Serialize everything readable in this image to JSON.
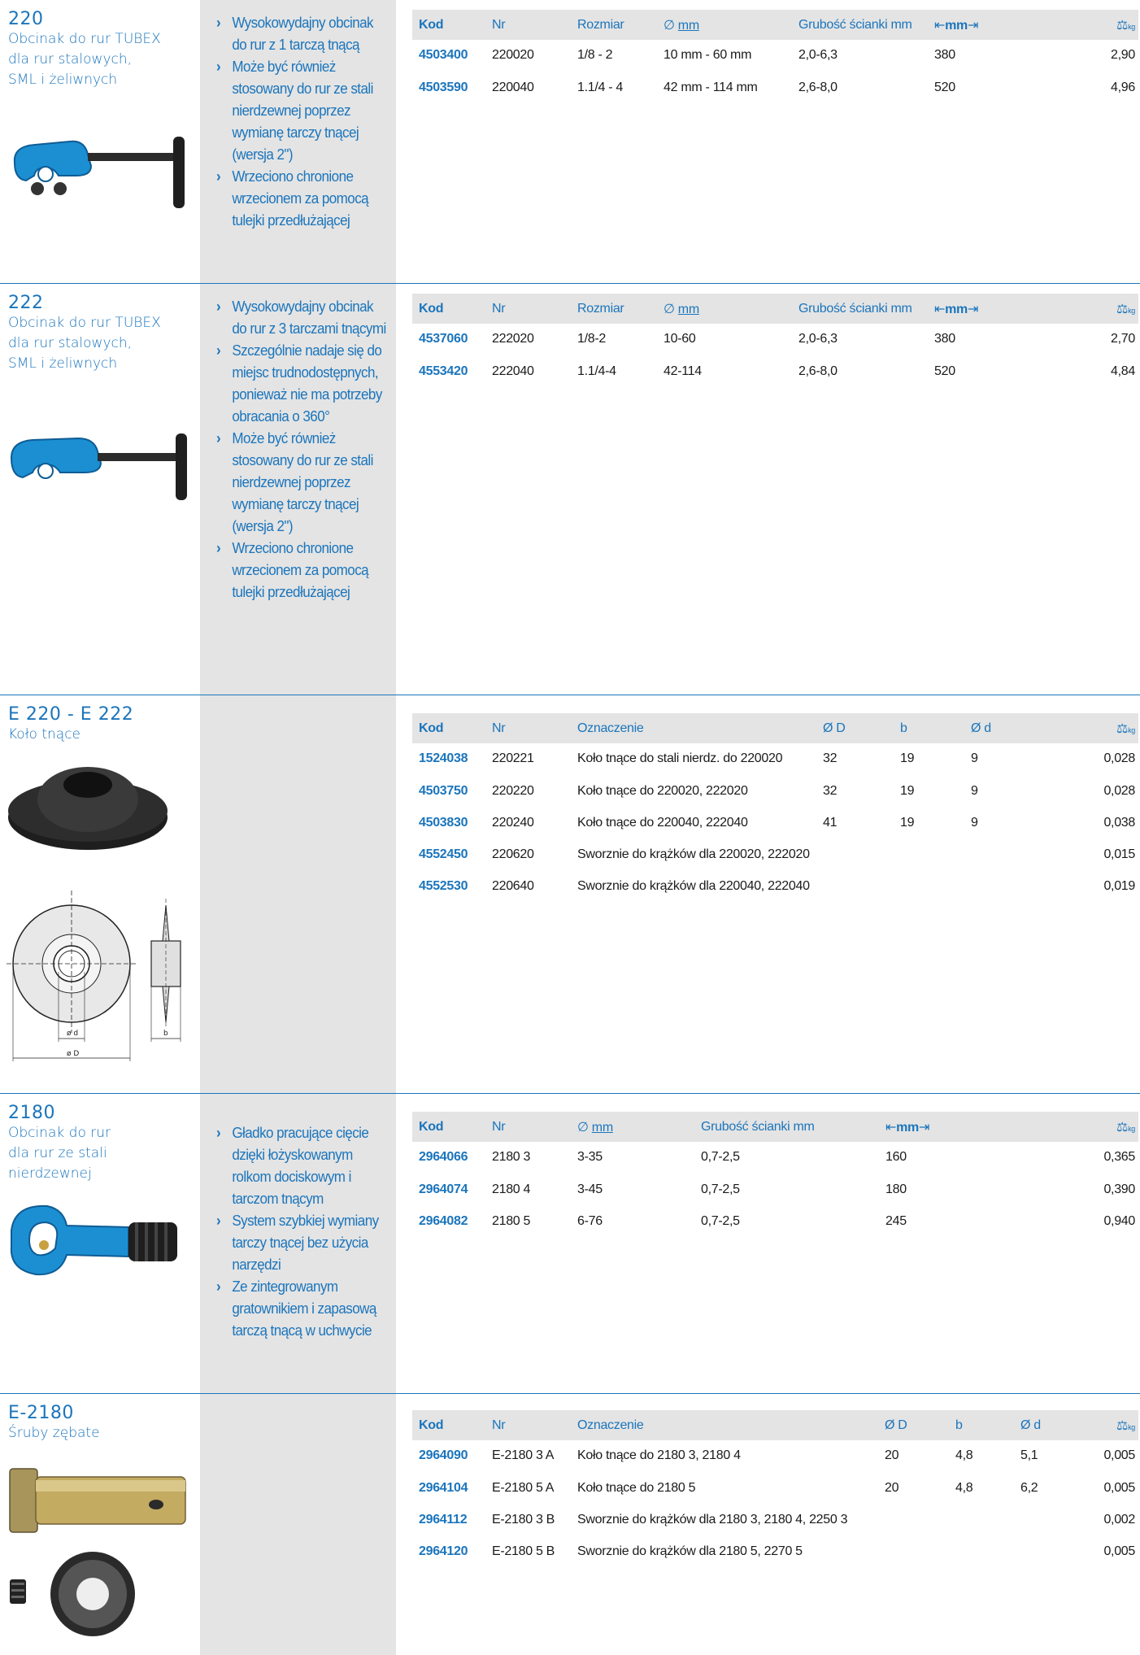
{
  "colors": {
    "accent": "#1b75bc",
    "panel": "#e4e4e4"
  },
  "sections": [
    {
      "number": "220",
      "title_lines": [
        "Obcinak do rur TUBEX",
        "dla rur stalowych,",
        "SML i żeliwnych"
      ],
      "features": [
        "Wysokowydajny obcinak do rur z 1 tarczą tnącą",
        "Może być również stosowany do rur ze stali nierdzewnej poprzez wymianę tarczy tnącej (wersja 2\")",
        "Wrzeciono chronione wrzecionem za pomocą tulejki przedłużającej"
      ],
      "headers": [
        "Kod",
        "Nr",
        "Rozmiar",
        "mm",
        "Grubość ścianki mm",
        "mm",
        "kg"
      ],
      "rows": [
        [
          "4503400",
          "220020",
          "1/8 - 2",
          "10 mm - 60 mm",
          "2,0-6,3",
          "380",
          "2,90"
        ],
        [
          "4503590",
          "220040",
          "1.1/4 - 4",
          "42 mm - 114 mm",
          "2,6-8,0",
          "520",
          "4,96"
        ]
      ]
    },
    {
      "number": "222",
      "title_lines": [
        "Obcinak do rur TUBEX",
        "dla rur stalowych,",
        "SML i żeliwnych"
      ],
      "features": [
        "Wysokowydajny obcinak do rur z 3 tarczami tnącymi",
        "Szczególnie nadaje się do miejsc trudnodostępnych, ponieważ nie ma potrzeby obracania o 360°",
        "Może być również stosowany do rur ze stali nierdzewnej poprzez wymianę tarczy tnącej (wersja 2\")",
        "Wrzeciono chronione wrzecionem za pomocą tulejki przedłużającej"
      ],
      "headers": [
        "Kod",
        "Nr",
        "Rozmiar",
        "mm",
        "Grubość ścianki mm",
        "mm",
        "kg"
      ],
      "rows": [
        [
          "4537060",
          "222020",
          "1/8-2",
          "10-60",
          "2,0-6,3",
          "380",
          "2,70"
        ],
        [
          "4553420",
          "222040",
          "1.1/4-4",
          "42-114",
          "2,6-8,0",
          "520",
          "4,84"
        ]
      ]
    },
    {
      "number": "E 220 - E 222",
      "title_lines": [
        "Koło tnące"
      ],
      "features": [],
      "headers": [
        "Kod",
        "Nr",
        "Oznaczenie",
        "Ø D",
        "b",
        "Ø d",
        "kg"
      ],
      "rows": [
        [
          "1524038",
          "220221",
          "Koło tnące do stali nierdz. do 220020",
          "32",
          "19",
          "9",
          "0,028"
        ],
        [
          "4503750",
          "220220",
          "Koło tnące do 220020, 222020",
          "32",
          "19",
          "9",
          "0,028"
        ],
        [
          "4503830",
          "220240",
          "Koło tnące do 220040, 222040",
          "41",
          "19",
          "9",
          "0,038"
        ],
        [
          "4552450",
          "220620",
          "Sworznie do krążków dla 220020, 222020",
          "",
          "",
          "",
          "0,015"
        ],
        [
          "4552530",
          "220640",
          "Sworznie do krążków dla 220040, 222040",
          "",
          "",
          "",
          "0,019"
        ]
      ],
      "diagram_labels": {
        "d": "ø d",
        "D": "ø D",
        "b": "b"
      }
    },
    {
      "number": "2180",
      "title_lines": [
        "Obcinak do rur",
        "dla rur ze stali",
        "nierdzewnej"
      ],
      "features": [
        "Gładko pracujące cięcie dzięki łożyskowanym rolkom dociskowym i tarczom tnącym",
        "System szybkiej wymiany tarczy tnącej bez użycia narzędzi",
        "Ze zintegrowanym gratownikiem i zapasową tarczą tnącą w uchwycie"
      ],
      "headers": [
        "Kod",
        "Nr",
        "mm",
        "Grubość ścianki mm",
        "mm",
        "kg"
      ],
      "rows": [
        [
          "2964066",
          "2180 3",
          "3-35",
          "0,7-2,5",
          "160",
          "0,365"
        ],
        [
          "2964074",
          "2180 4",
          "3-45",
          "0,7-2,5",
          "180",
          "0,390"
        ],
        [
          "2964082",
          "2180 5",
          "6-76",
          "0,7-2,5",
          "245",
          "0,940"
        ]
      ]
    },
    {
      "number": "E-2180",
      "title_lines": [
        "Śruby zębate"
      ],
      "features": [],
      "headers": [
        "Kod",
        "Nr",
        "Oznaczenie",
        "Ø D",
        "b",
        "Ø d",
        "kg"
      ],
      "rows": [
        [
          "2964090",
          "E-2180 3 A",
          "Koło tnące do 2180 3, 2180 4",
          "20",
          "4,8",
          "5,1",
          "0,005"
        ],
        [
          "2964104",
          "E-2180 5 A",
          "Koło tnące do 2180 5",
          "20",
          "4,8",
          "6,2",
          "0,005"
        ],
        [
          "2964112",
          "E-2180 3 B",
          "Sworznie do krążków dla 2180 3, 2180 4, 2250 3",
          "",
          "",
          "",
          "0,002"
        ],
        [
          "2964120",
          "E-2180 5 B",
          "Sworznie do krążków dla 2180 5, 2270 5",
          "",
          "",
          "",
          "0,005"
        ]
      ]
    }
  ]
}
